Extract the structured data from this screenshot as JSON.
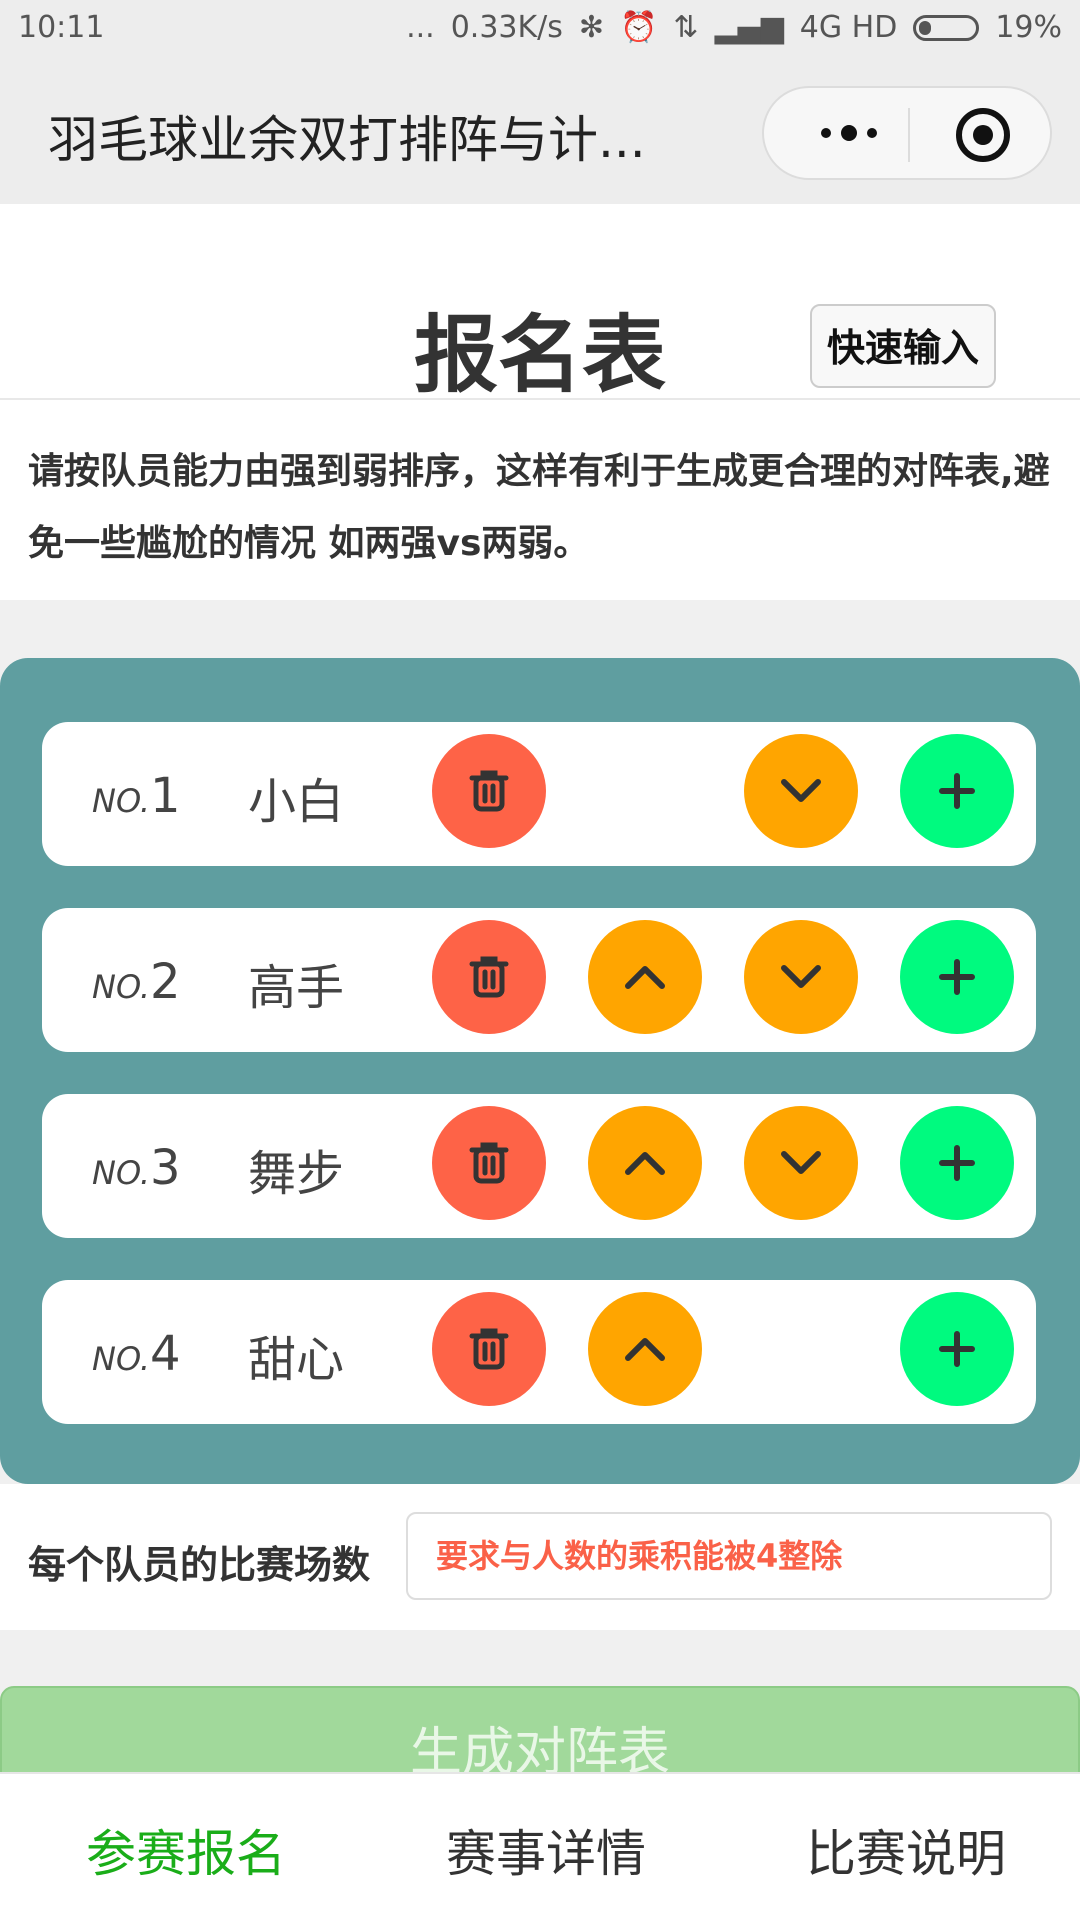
{
  "status_bar": {
    "time": "10:11",
    "dots": "...",
    "net_speed": "0.33K/s",
    "network": "4G HD",
    "battery": "19%"
  },
  "nav": {
    "title": "羽毛球业余双打排阵与计...",
    "more_icon": "more-dots-icon",
    "close_icon": "target-circle-icon"
  },
  "header": {
    "title": "报名表",
    "quick_input_label": "快速输入"
  },
  "notice": "请按队员能力由强到弱排序，这样有利于生成更合理的对阵表,避免一些尴尬的情况 如两强vs两弱。",
  "players": [
    {
      "no_prefix": "NO.",
      "number": "1",
      "name": "小白",
      "has_up": false,
      "has_down": true
    },
    {
      "no_prefix": "NO.",
      "number": "2",
      "name": "高手",
      "has_up": true,
      "has_down": true
    },
    {
      "no_prefix": "NO.",
      "number": "3",
      "name": "舞步",
      "has_up": true,
      "has_down": true
    },
    {
      "no_prefix": "NO.",
      "number": "4",
      "name": "甜心",
      "has_up": true,
      "has_down": false
    }
  ],
  "matches": {
    "label": "每个队员的比赛场数",
    "placeholder": "要求与人数的乘积能被4整除"
  },
  "generate_button": "生成对阵表",
  "tabs": [
    {
      "label": "参赛报名",
      "active": true
    },
    {
      "label": "赛事详情",
      "active": false
    },
    {
      "label": "比赛说明",
      "active": false
    }
  ],
  "colors": {
    "panel": "#5f9ea0",
    "delete": "#fe6347",
    "move": "#ffa500",
    "add": "#00fa7f",
    "tab_active": "#1aad19",
    "generate": "#a1d99b"
  }
}
